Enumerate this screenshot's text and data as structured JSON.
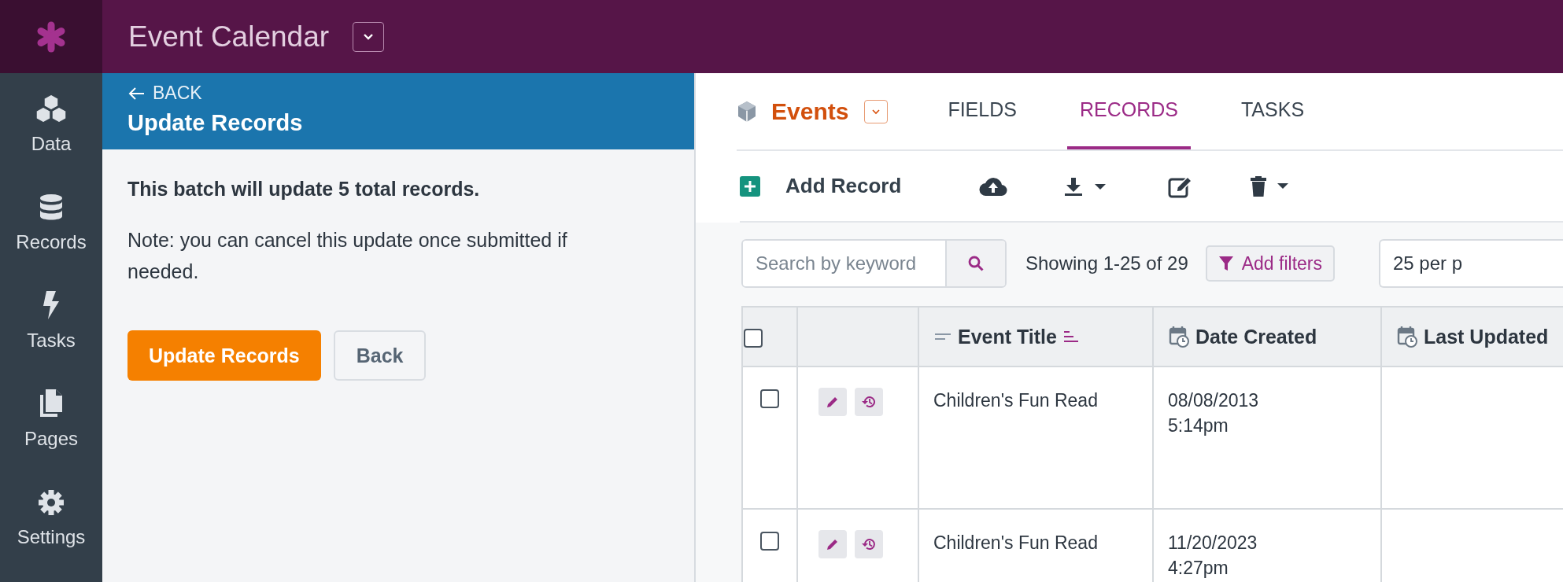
{
  "app": {
    "title": "Event Calendar"
  },
  "nav": [
    {
      "label": "Data"
    },
    {
      "label": "Records"
    },
    {
      "label": "Tasks"
    },
    {
      "label": "Pages"
    },
    {
      "label": "Settings"
    }
  ],
  "panel": {
    "back": "BACK",
    "title": "Update Records",
    "summary": "This batch will update 5 total records.",
    "note": "Note: you can cancel this update once submitted if needed.",
    "buttons": [
      {
        "label": "Update Records",
        "kind": "primary"
      },
      {
        "label": "Back",
        "kind": "secondary"
      }
    ]
  },
  "object": {
    "name": "Events"
  },
  "tabs": [
    {
      "label": "FIELDS",
      "selected": false
    },
    {
      "label": "RECORDS",
      "selected": true
    },
    {
      "label": "TASKS",
      "selected": false
    }
  ],
  "toolbar": {
    "add_label": "Add Record"
  },
  "search": {
    "placeholder": "Search by keyword"
  },
  "count": "Showing 1-25 of 29",
  "filters": "Add filters",
  "per_page": "25 per p",
  "table": {
    "select_all_checked": false,
    "columns": [
      {
        "label": "Event Title",
        "kind": "text",
        "sorted": true
      },
      {
        "label": "Date Created",
        "kind": "date",
        "sorted": false
      },
      {
        "label": "Last Updated",
        "kind": "date",
        "sorted": false
      }
    ],
    "rows": [
      {
        "checked": false,
        "event_title": "Children's Fun Read",
        "date_created": {
          "date": "08/08/2013",
          "time": "5:14pm"
        }
      },
      {
        "checked": false,
        "event_title": "Children's Fun Read",
        "date_created": {
          "date": "11/20/2023",
          "time": "4:27pm"
        }
      }
    ]
  }
}
